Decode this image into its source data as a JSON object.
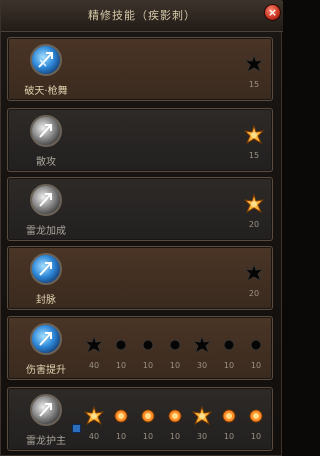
{
  "window": {
    "title": "精修技能（疾影刺）",
    "close_label": "×"
  },
  "colors": {
    "gold_glow": "#ffb23a",
    "gold_core": "#ffe08a",
    "inactive_star": "#050505",
    "row_brown": "#3f2e22",
    "row_gray": "#262422"
  },
  "skills": [
    {
      "name": "破天·枪舞",
      "icon": "spear-dance-icon",
      "nodes": [
        {
          "value": "15",
          "active": false
        }
      ]
    },
    {
      "name": "散攻",
      "icon": "scatter-attack-icon",
      "nodes": [
        {
          "value": "15",
          "active": true
        }
      ]
    },
    {
      "name": "雷龙加成",
      "icon": "thunder-dragon-boost-icon",
      "nodes": [
        {
          "value": "20",
          "active": true
        }
      ]
    },
    {
      "name": "封脉",
      "icon": "seal-meridian-icon",
      "nodes": [
        {
          "value": "20",
          "active": false
        }
      ]
    },
    {
      "name": "伤害提升",
      "icon": "damage-up-icon",
      "nodes": [
        {
          "value": "40",
          "active": false
        },
        {
          "value": "10",
          "active": false
        },
        {
          "value": "10",
          "active": false
        },
        {
          "value": "10",
          "active": false
        },
        {
          "value": "30",
          "active": false
        },
        {
          "value": "10",
          "active": false
        },
        {
          "value": "10",
          "active": false
        }
      ]
    },
    {
      "name": "雷龙护主",
      "icon": "thunder-dragon-guard-icon",
      "nodes": [
        {
          "value": "40",
          "active": true
        },
        {
          "value": "10",
          "active": true
        },
        {
          "value": "10",
          "active": true
        },
        {
          "value": "10",
          "active": true
        },
        {
          "value": "30",
          "active": true
        },
        {
          "value": "10",
          "active": true
        },
        {
          "value": "10",
          "active": true
        }
      ]
    }
  ]
}
